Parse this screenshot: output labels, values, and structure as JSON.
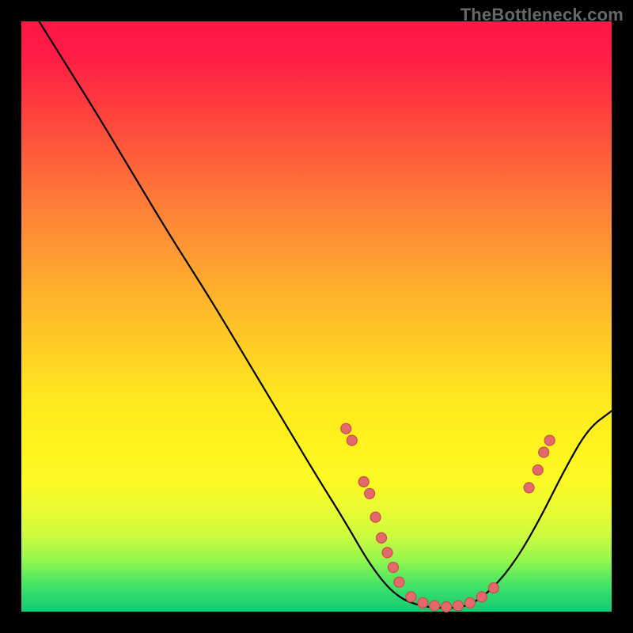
{
  "watermark": "TheBottleneck.com",
  "colors": {
    "marker_fill": "#e26a6a",
    "marker_stroke": "#c94d4d",
    "curve": "#000000",
    "background_frame": "#000000"
  },
  "chart_data": {
    "type": "line",
    "title": "",
    "xlabel": "",
    "ylabel": "",
    "xlim": [
      0,
      100
    ],
    "ylim": [
      0,
      100
    ],
    "grid": false,
    "curve": [
      {
        "x": 3,
        "y": 100
      },
      {
        "x": 8,
        "y": 92
      },
      {
        "x": 13,
        "y": 84
      },
      {
        "x": 19,
        "y": 74
      },
      {
        "x": 25,
        "y": 64
      },
      {
        "x": 32,
        "y": 53
      },
      {
        "x": 38,
        "y": 43
      },
      {
        "x": 44,
        "y": 33
      },
      {
        "x": 50,
        "y": 23
      },
      {
        "x": 55,
        "y": 15
      },
      {
        "x": 59,
        "y": 8
      },
      {
        "x": 63,
        "y": 3
      },
      {
        "x": 67,
        "y": 1
      },
      {
        "x": 72,
        "y": 0.5
      },
      {
        "x": 76,
        "y": 1
      },
      {
        "x": 80,
        "y": 4
      },
      {
        "x": 84,
        "y": 9
      },
      {
        "x": 88,
        "y": 16
      },
      {
        "x": 92,
        "y": 24
      },
      {
        "x": 96,
        "y": 31
      },
      {
        "x": 100,
        "y": 34
      }
    ],
    "markers": [
      {
        "x": 55,
        "y": 31
      },
      {
        "x": 56,
        "y": 29
      },
      {
        "x": 58,
        "y": 22
      },
      {
        "x": 59,
        "y": 20
      },
      {
        "x": 60,
        "y": 16
      },
      {
        "x": 61,
        "y": 12.5
      },
      {
        "x": 62,
        "y": 10
      },
      {
        "x": 63,
        "y": 7.5
      },
      {
        "x": 64,
        "y": 5
      },
      {
        "x": 66,
        "y": 2.5
      },
      {
        "x": 68,
        "y": 1.5
      },
      {
        "x": 70,
        "y": 1
      },
      {
        "x": 72,
        "y": 0.8
      },
      {
        "x": 74,
        "y": 1
      },
      {
        "x": 76,
        "y": 1.5
      },
      {
        "x": 78,
        "y": 2.5
      },
      {
        "x": 80,
        "y": 4
      },
      {
        "x": 86,
        "y": 21
      },
      {
        "x": 87.5,
        "y": 24
      },
      {
        "x": 88.5,
        "y": 27
      },
      {
        "x": 89.5,
        "y": 29
      }
    ]
  }
}
